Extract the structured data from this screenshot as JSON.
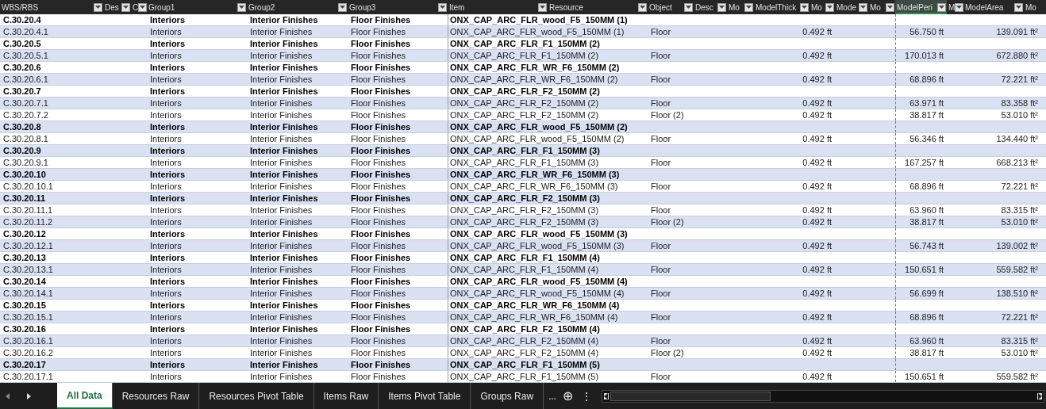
{
  "columns": [
    {
      "label": "WBS/RBS",
      "selected": false,
      "filter": true
    },
    {
      "label": "Des",
      "selected": false,
      "filter": true
    },
    {
      "label": "C",
      "selected": false,
      "filter": true
    },
    {
      "label": "Group1",
      "selected": false,
      "filter": true
    },
    {
      "label": "Group2",
      "selected": false,
      "filter": true
    },
    {
      "label": "Group3",
      "selected": false,
      "filter": true
    },
    {
      "label": "Item",
      "selected": false,
      "filter": true
    },
    {
      "label": "Resource",
      "selected": false,
      "filter": true
    },
    {
      "label": "Object",
      "selected": false,
      "filter": true
    },
    {
      "label": "Desc",
      "selected": false,
      "filter": true
    },
    {
      "label": "Mo",
      "selected": false,
      "filter": true
    },
    {
      "label": "ModelThick",
      "selected": false,
      "filter": true
    },
    {
      "label": "Mo",
      "selected": false,
      "filter": true
    },
    {
      "label": "Mode",
      "selected": false,
      "filter": true
    },
    {
      "label": "Mo",
      "selected": false,
      "filter": true
    },
    {
      "label": "ModelPeri",
      "selected": true,
      "filter": true
    },
    {
      "label": "M",
      "selected": false,
      "filter": true
    },
    {
      "label": "ModelArea",
      "selected": false,
      "filter": true
    },
    {
      "label": "Mo",
      "selected": false,
      "filter": false
    }
  ],
  "rows": [
    {
      "kind": "group",
      "wbs": "C.30.20.4",
      "group1": "Interiors",
      "group2": "Interior Finishes",
      "group3": "Floor Finishes",
      "item": "ONX_CAP_ARC_FLR_wood_F5_150MM (1)"
    },
    {
      "kind": "detail",
      "wbs": "C.30.20.4.1",
      "group1": "Interiors",
      "group2": "Interior Finishes",
      "group3": "Floor Finishes",
      "item": "ONX_CAP_ARC_FLR_wood_F5_150MM (1)",
      "object": "Floor",
      "thickness": "0.492 ft",
      "perimeter": "56.750 ft",
      "area": "139.091 ft²"
    },
    {
      "kind": "group",
      "wbs": "C.30.20.5",
      "group1": "Interiors",
      "group2": "Interior Finishes",
      "group3": "Floor Finishes",
      "item": "ONX_CAP_ARC_FLR_F1_150MM (2)"
    },
    {
      "kind": "detail",
      "wbs": "C.30.20.5.1",
      "group1": "Interiors",
      "group2": "Interior Finishes",
      "group3": "Floor Finishes",
      "item": "ONX_CAP_ARC_FLR_F1_150MM (2)",
      "object": "Floor",
      "thickness": "0.492 ft",
      "perimeter": "170.013 ft",
      "area": "672.880 ft²"
    },
    {
      "kind": "group",
      "wbs": "C.30.20.6",
      "group1": "Interiors",
      "group2": "Interior Finishes",
      "group3": "Floor Finishes",
      "item": "ONX_CAP_ARC_FLR_WR_F6_150MM (2)"
    },
    {
      "kind": "detail",
      "wbs": "C.30.20.6.1",
      "group1": "Interiors",
      "group2": "Interior Finishes",
      "group3": "Floor Finishes",
      "item": "ONX_CAP_ARC_FLR_WR_F6_150MM (2)",
      "object": "Floor",
      "thickness": "0.492 ft",
      "perimeter": "68.896 ft",
      "area": "72.221 ft²"
    },
    {
      "kind": "group",
      "wbs": "C.30.20.7",
      "group1": "Interiors",
      "group2": "Interior Finishes",
      "group3": "Floor Finishes",
      "item": "ONX_CAP_ARC_FLR_F2_150MM (2)"
    },
    {
      "kind": "detail",
      "wbs": "C.30.20.7.1",
      "group1": "Interiors",
      "group2": "Interior Finishes",
      "group3": "Floor Finishes",
      "item": "ONX_CAP_ARC_FLR_F2_150MM (2)",
      "object": "Floor",
      "thickness": "0.492 ft",
      "perimeter": "63.971 ft",
      "area": "83.358 ft²"
    },
    {
      "kind": "detail",
      "wbs": "C.30.20.7.2",
      "group1": "Interiors",
      "group2": "Interior Finishes",
      "group3": "Floor Finishes",
      "item": "ONX_CAP_ARC_FLR_F2_150MM (2)",
      "object": "Floor (2)",
      "thickness": "0.492 ft",
      "perimeter": "38.817 ft",
      "area": "53.010 ft²"
    },
    {
      "kind": "group",
      "wbs": "C.30.20.8",
      "group1": "Interiors",
      "group2": "Interior Finishes",
      "group3": "Floor Finishes",
      "item": "ONX_CAP_ARC_FLR_wood_F5_150MM (2)"
    },
    {
      "kind": "detail",
      "wbs": "C.30.20.8.1",
      "group1": "Interiors",
      "group2": "Interior Finishes",
      "group3": "Floor Finishes",
      "item": "ONX_CAP_ARC_FLR_wood_F5_150MM (2)",
      "object": "Floor",
      "thickness": "0.492 ft",
      "perimeter": "56.346 ft",
      "area": "134.440 ft²"
    },
    {
      "kind": "group",
      "wbs": "C.30.20.9",
      "group1": "Interiors",
      "group2": "Interior Finishes",
      "group3": "Floor Finishes",
      "item": "ONX_CAP_ARC_FLR_F1_150MM (3)"
    },
    {
      "kind": "detail",
      "wbs": "C.30.20.9.1",
      "group1": "Interiors",
      "group2": "Interior Finishes",
      "group3": "Floor Finishes",
      "item": "ONX_CAP_ARC_FLR_F1_150MM (3)",
      "object": "Floor",
      "thickness": "0.492 ft",
      "perimeter": "167.257 ft",
      "area": "668.213 ft²"
    },
    {
      "kind": "group",
      "wbs": "C.30.20.10",
      "group1": "Interiors",
      "group2": "Interior Finishes",
      "group3": "Floor Finishes",
      "item": "ONX_CAP_ARC_FLR_WR_F6_150MM (3)"
    },
    {
      "kind": "detail",
      "wbs": "C.30.20.10.1",
      "group1": "Interiors",
      "group2": "Interior Finishes",
      "group3": "Floor Finishes",
      "item": "ONX_CAP_ARC_FLR_WR_F6_150MM (3)",
      "object": "Floor",
      "thickness": "0.492 ft",
      "perimeter": "68.896 ft",
      "area": "72.221 ft²"
    },
    {
      "kind": "group",
      "wbs": "C.30.20.11",
      "group1": "Interiors",
      "group2": "Interior Finishes",
      "group3": "Floor Finishes",
      "item": "ONX_CAP_ARC_FLR_F2_150MM (3)"
    },
    {
      "kind": "detail",
      "wbs": "C.30.20.11.1",
      "group1": "Interiors",
      "group2": "Interior Finishes",
      "group3": "Floor Finishes",
      "item": "ONX_CAP_ARC_FLR_F2_150MM (3)",
      "object": "Floor",
      "thickness": "0.492 ft",
      "perimeter": "63.960 ft",
      "area": "83.315 ft²"
    },
    {
      "kind": "detail",
      "wbs": "C.30.20.11.2",
      "group1": "Interiors",
      "group2": "Interior Finishes",
      "group3": "Floor Finishes",
      "item": "ONX_CAP_ARC_FLR_F2_150MM (3)",
      "object": "Floor (2)",
      "thickness": "0.492 ft",
      "perimeter": "38.817 ft",
      "area": "53.010 ft²"
    },
    {
      "kind": "group",
      "wbs": "C.30.20.12",
      "group1": "Interiors",
      "group2": "Interior Finishes",
      "group3": "Floor Finishes",
      "item": "ONX_CAP_ARC_FLR_wood_F5_150MM (3)"
    },
    {
      "kind": "detail",
      "wbs": "C.30.20.12.1",
      "group1": "Interiors",
      "group2": "Interior Finishes",
      "group3": "Floor Finishes",
      "item": "ONX_CAP_ARC_FLR_wood_F5_150MM (3)",
      "object": "Floor",
      "thickness": "0.492 ft",
      "perimeter": "56.743 ft",
      "area": "139.002 ft²"
    },
    {
      "kind": "group",
      "wbs": "C.30.20.13",
      "group1": "Interiors",
      "group2": "Interior Finishes",
      "group3": "Floor Finishes",
      "item": "ONX_CAP_ARC_FLR_F1_150MM (4)"
    },
    {
      "kind": "detail",
      "wbs": "C.30.20.13.1",
      "group1": "Interiors",
      "group2": "Interior Finishes",
      "group3": "Floor Finishes",
      "item": "ONX_CAP_ARC_FLR_F1_150MM (4)",
      "object": "Floor",
      "thickness": "0.492 ft",
      "perimeter": "150.651 ft",
      "area": "559.582 ft²"
    },
    {
      "kind": "group",
      "wbs": "C.30.20.14",
      "group1": "Interiors",
      "group2": "Interior Finishes",
      "group3": "Floor Finishes",
      "item": "ONX_CAP_ARC_FLR_wood_F5_150MM (4)"
    },
    {
      "kind": "detail",
      "wbs": "C.30.20.14.1",
      "group1": "Interiors",
      "group2": "Interior Finishes",
      "group3": "Floor Finishes",
      "item": "ONX_CAP_ARC_FLR_wood_F5_150MM (4)",
      "object": "Floor",
      "thickness": "0.492 ft",
      "perimeter": "56.699 ft",
      "area": "138.510 ft²"
    },
    {
      "kind": "group",
      "wbs": "C.30.20.15",
      "group1": "Interiors",
      "group2": "Interior Finishes",
      "group3": "Floor Finishes",
      "item": "ONX_CAP_ARC_FLR_WR_F6_150MM (4)"
    },
    {
      "kind": "detail",
      "wbs": "C.30.20.15.1",
      "group1": "Interiors",
      "group2": "Interior Finishes",
      "group3": "Floor Finishes",
      "item": "ONX_CAP_ARC_FLR_WR_F6_150MM (4)",
      "object": "Floor",
      "thickness": "0.492 ft",
      "perimeter": "68.896 ft",
      "area": "72.221 ft²"
    },
    {
      "kind": "group",
      "wbs": "C.30.20.16",
      "group1": "Interiors",
      "group2": "Interior Finishes",
      "group3": "Floor Finishes",
      "item": "ONX_CAP_ARC_FLR_F2_150MM (4)"
    },
    {
      "kind": "detail",
      "wbs": "C.30.20.16.1",
      "group1": "Interiors",
      "group2": "Interior Finishes",
      "group3": "Floor Finishes",
      "item": "ONX_CAP_ARC_FLR_F2_150MM (4)",
      "object": "Floor",
      "thickness": "0.492 ft",
      "perimeter": "63.960 ft",
      "area": "83.315 ft²"
    },
    {
      "kind": "detail",
      "wbs": "C.30.20.16.2",
      "group1": "Interiors",
      "group2": "Interior Finishes",
      "group3": "Floor Finishes",
      "item": "ONX_CAP_ARC_FLR_F2_150MM (4)",
      "object": "Floor (2)",
      "thickness": "0.492 ft",
      "perimeter": "38.817 ft",
      "area": "53.010 ft²"
    },
    {
      "kind": "group",
      "wbs": "C.30.20.17",
      "group1": "Interiors",
      "group2": "Interior Finishes",
      "group3": "Floor Finishes",
      "item": "ONX_CAP_ARC_FLR_F1_150MM (5)"
    },
    {
      "kind": "detail",
      "wbs": "C.30.20.17.1",
      "group1": "Interiors",
      "group2": "Interior Finishes",
      "group3": "Floor Finishes",
      "item": "ONX_CAP_ARC_FLR_F1_150MM (5)",
      "object": "Floor",
      "thickness": "0.492 ft",
      "perimeter": "150.651 ft",
      "area": "559.582 ft²"
    }
  ],
  "sheet_tabs": [
    {
      "label": "All Data",
      "selected": true
    },
    {
      "label": "Resources Raw",
      "selected": false
    },
    {
      "label": "Resources Pivot Table",
      "selected": false
    },
    {
      "label": "Items Raw",
      "selected": false
    },
    {
      "label": "Items Pivot Table",
      "selected": false
    },
    {
      "label": "Groups Raw",
      "selected": false
    }
  ],
  "more_tabs": "...",
  "add_sheet": "⊕",
  "tab_menu": "⋮"
}
